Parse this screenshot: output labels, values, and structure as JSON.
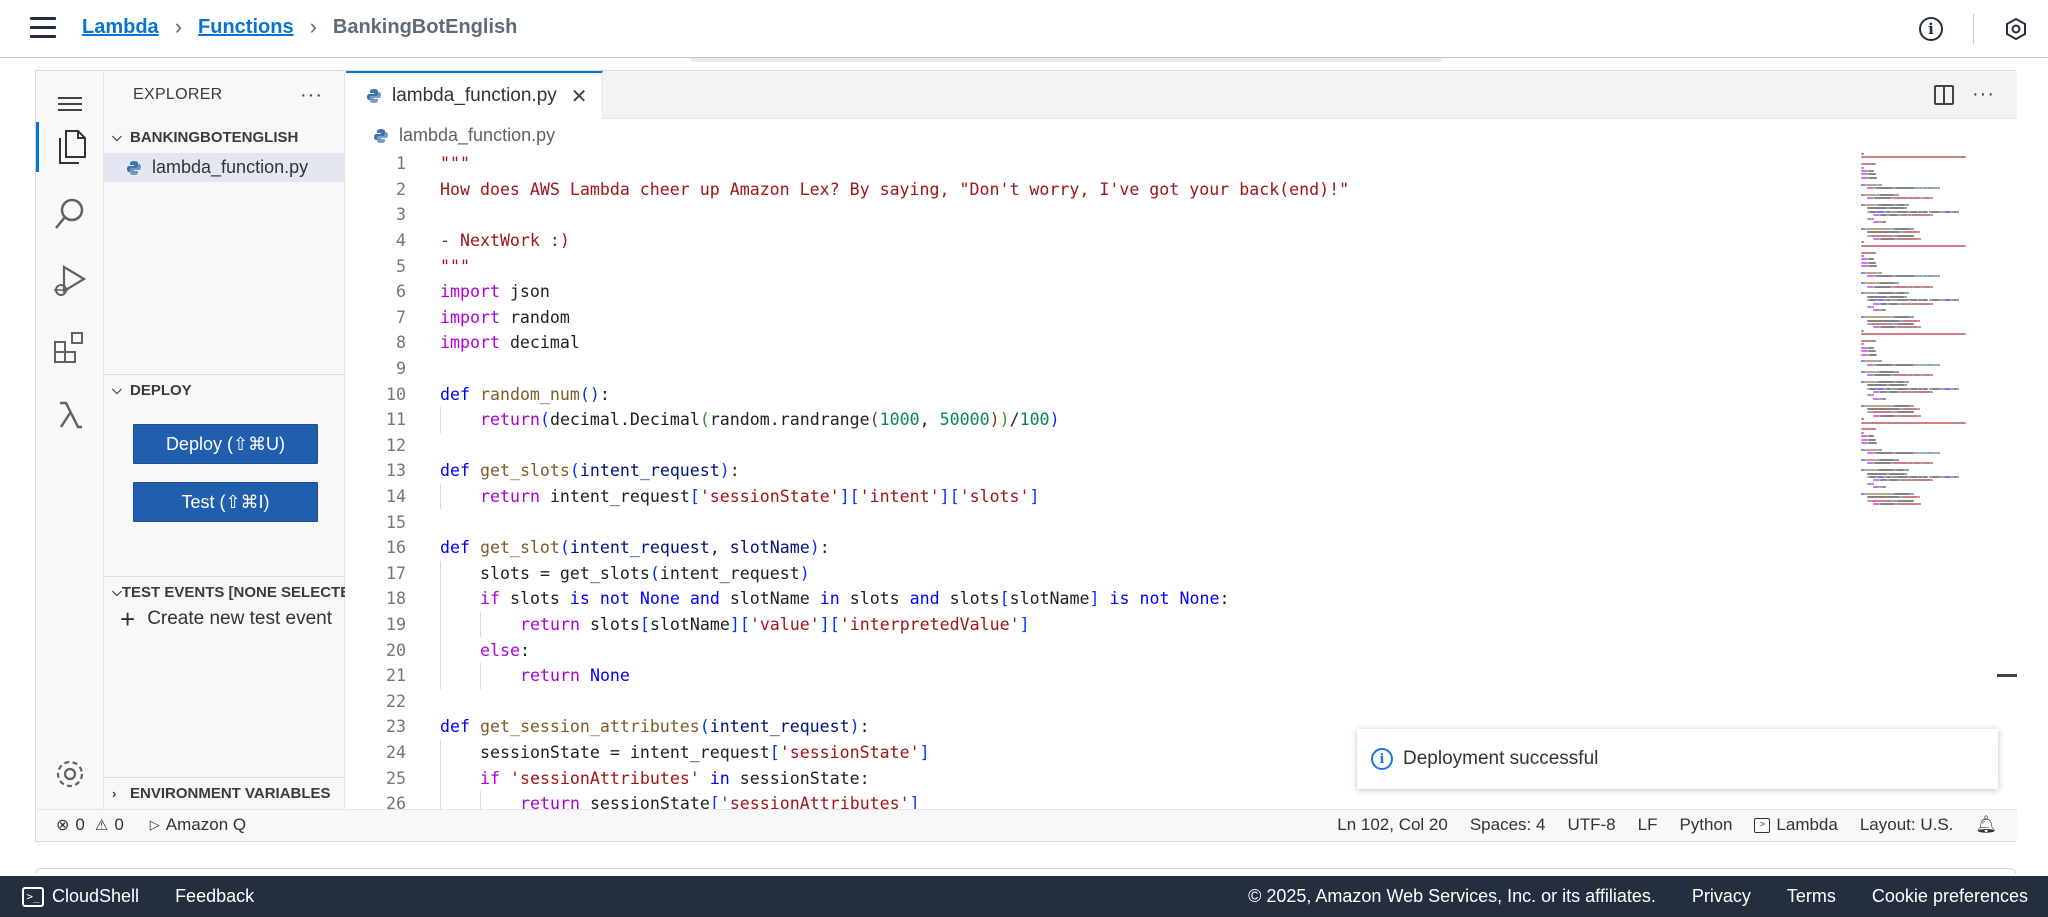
{
  "breadcrumb": {
    "items": [
      "Lambda",
      "Functions"
    ],
    "current": "BankingBotEnglish"
  },
  "sidebar": {
    "explorer_title": "EXPLORER",
    "folder_name": "BANKINGBOTENGLISH",
    "file_name": "lambda_function.py",
    "deploy_section": "DEPLOY",
    "deploy_button": "Deploy (⇧⌘U)",
    "test_button": "Test (⇧⌘I)",
    "test_events_section": "TEST EVENTS [NONE SELECTED]",
    "create_test_event": "Create new test event",
    "env_section": "ENVIRONMENT VARIABLES"
  },
  "editor": {
    "tab_label": "lambda_function.py",
    "path": "lambda_function.py"
  },
  "code_lines": [
    {
      "n": "1",
      "indent": 0,
      "tokens": [
        [
          "str",
          "\"\"\""
        ]
      ]
    },
    {
      "n": "2",
      "indent": 0,
      "tokens": [
        [
          "str",
          "How does AWS Lambda cheer up Amazon Lex? By saying, \"Don't worry, I've got your back(end)!\""
        ]
      ]
    },
    {
      "n": "3",
      "indent": 0,
      "tokens": []
    },
    {
      "n": "4",
      "indent": 0,
      "tokens": [
        [
          "str",
          "- NextWork :)"
        ]
      ]
    },
    {
      "n": "5",
      "indent": 0,
      "tokens": [
        [
          "str",
          "\"\"\""
        ]
      ]
    },
    {
      "n": "6",
      "indent": 0,
      "tokens": [
        [
          "kw",
          "import"
        ],
        [
          "",
          " json"
        ]
      ]
    },
    {
      "n": "7",
      "indent": 0,
      "tokens": [
        [
          "kw",
          "import"
        ],
        [
          "",
          " random"
        ]
      ]
    },
    {
      "n": "8",
      "indent": 0,
      "tokens": [
        [
          "kw",
          "import"
        ],
        [
          "",
          " decimal"
        ]
      ]
    },
    {
      "n": "9",
      "indent": 0,
      "tokens": []
    },
    {
      "n": "10",
      "indent": 0,
      "tokens": [
        [
          "kw2",
          "def"
        ],
        [
          "",
          " "
        ],
        [
          "fn",
          "random_num"
        ],
        [
          "brk",
          "()"
        ],
        [
          "",
          ":"
        ]
      ]
    },
    {
      "n": "11",
      "indent": 1,
      "tokens": [
        [
          "kw",
          "return"
        ],
        [
          "brk",
          "("
        ],
        [
          "",
          "decimal.Decimal"
        ],
        [
          "brk2",
          "("
        ],
        [
          "",
          "random.randrange"
        ],
        [
          "brk3",
          "("
        ],
        [
          "num",
          "1000"
        ],
        [
          "",
          ", "
        ],
        [
          "num",
          "50000"
        ],
        [
          "brk3",
          ")"
        ],
        [
          "brk2",
          ")"
        ],
        [
          "",
          "/"
        ],
        [
          "num",
          "100"
        ],
        [
          "brk",
          ")"
        ]
      ]
    },
    {
      "n": "12",
      "indent": 0,
      "tokens": []
    },
    {
      "n": "13",
      "indent": 0,
      "tokens": [
        [
          "kw2",
          "def"
        ],
        [
          "",
          " "
        ],
        [
          "fn",
          "get_slots"
        ],
        [
          "brk",
          "("
        ],
        [
          "prm",
          "intent_request"
        ],
        [
          "brk",
          ")"
        ],
        [
          "",
          ":"
        ]
      ]
    },
    {
      "n": "14",
      "indent": 1,
      "tokens": [
        [
          "kw",
          "return"
        ],
        [
          "",
          " intent_request"
        ],
        [
          "brk",
          "["
        ],
        [
          "str",
          "'sessionState'"
        ],
        [
          "brk",
          "]["
        ],
        [
          "str",
          "'intent'"
        ],
        [
          "brk",
          "]["
        ],
        [
          "str",
          "'slots'"
        ],
        [
          "brk",
          "]"
        ]
      ]
    },
    {
      "n": "15",
      "indent": 0,
      "tokens": []
    },
    {
      "n": "16",
      "indent": 0,
      "tokens": [
        [
          "kw2",
          "def"
        ],
        [
          "",
          " "
        ],
        [
          "fn",
          "get_slot"
        ],
        [
          "brk",
          "("
        ],
        [
          "prm",
          "intent_request"
        ],
        [
          "",
          ", "
        ],
        [
          "prm",
          "slotName"
        ],
        [
          "brk",
          ")"
        ],
        [
          "",
          ":"
        ]
      ]
    },
    {
      "n": "17",
      "indent": 1,
      "tokens": [
        [
          "",
          "slots = get_slots"
        ],
        [
          "brk",
          "("
        ],
        [
          "",
          "intent_request"
        ],
        [
          "brk",
          ")"
        ]
      ]
    },
    {
      "n": "18",
      "indent": 1,
      "tokens": [
        [
          "kw",
          "if"
        ],
        [
          "",
          " slots "
        ],
        [
          "kw2",
          "is not"
        ],
        [
          "",
          " "
        ],
        [
          "cnst",
          "None"
        ],
        [
          "",
          " "
        ],
        [
          "kw2",
          "and"
        ],
        [
          "",
          " slotName "
        ],
        [
          "kw2",
          "in"
        ],
        [
          "",
          " slots "
        ],
        [
          "kw2",
          "and"
        ],
        [
          "",
          " slots"
        ],
        [
          "brk",
          "["
        ],
        [
          "",
          "slotName"
        ],
        [
          "brk",
          "]"
        ],
        [
          "",
          " "
        ],
        [
          "kw2",
          "is not"
        ],
        [
          "",
          " "
        ],
        [
          "cnst",
          "None"
        ],
        [
          "",
          ":"
        ]
      ]
    },
    {
      "n": "19",
      "indent": 2,
      "tokens": [
        [
          "kw",
          "return"
        ],
        [
          "",
          " slots"
        ],
        [
          "brk",
          "["
        ],
        [
          "",
          "slotName"
        ],
        [
          "brk",
          "]["
        ],
        [
          "str",
          "'value'"
        ],
        [
          "brk",
          "]["
        ],
        [
          "str",
          "'interpretedValue'"
        ],
        [
          "brk",
          "]"
        ]
      ]
    },
    {
      "n": "20",
      "indent": 1,
      "tokens": [
        [
          "kw",
          "else"
        ],
        [
          "",
          ":"
        ]
      ]
    },
    {
      "n": "21",
      "indent": 2,
      "tokens": [
        [
          "kw",
          "return"
        ],
        [
          "",
          " "
        ],
        [
          "cnst",
          "None"
        ]
      ]
    },
    {
      "n": "22",
      "indent": 0,
      "tokens": []
    },
    {
      "n": "23",
      "indent": 0,
      "tokens": [
        [
          "kw2",
          "def"
        ],
        [
          "",
          " "
        ],
        [
          "fn",
          "get_session_attributes"
        ],
        [
          "brk",
          "("
        ],
        [
          "prm",
          "intent_request"
        ],
        [
          "brk",
          ")"
        ],
        [
          "",
          ":"
        ]
      ]
    },
    {
      "n": "24",
      "indent": 1,
      "tokens": [
        [
          "",
          "sessionState = intent_request"
        ],
        [
          "brk",
          "["
        ],
        [
          "str",
          "'sessionState'"
        ],
        [
          "brk",
          "]"
        ]
      ]
    },
    {
      "n": "25",
      "indent": 1,
      "tokens": [
        [
          "kw",
          "if"
        ],
        [
          "",
          " "
        ],
        [
          "str",
          "'sessionAttributes'"
        ],
        [
          "",
          " "
        ],
        [
          "kw2",
          "in"
        ],
        [
          "",
          " sessionState:"
        ]
      ]
    },
    {
      "n": "26",
      "indent": 2,
      "tokens": [
        [
          "kw",
          "return"
        ],
        [
          "",
          " sessionState"
        ],
        [
          "brk",
          "["
        ],
        [
          "str",
          "'sessionAttributes'"
        ],
        [
          "brk",
          "]"
        ]
      ]
    }
  ],
  "toast": {
    "message": "Deployment successful"
  },
  "statusbar": {
    "errors": "0",
    "warnings": "0",
    "amazon_q": "Amazon Q",
    "position": "Ln 102, Col 20",
    "spaces": "Spaces: 4",
    "encoding": "UTF-8",
    "eol": "LF",
    "language": "Python",
    "lambda": "Lambda",
    "layout": "Layout: U.S."
  },
  "footer": {
    "cloudshell": "CloudShell",
    "feedback": "Feedback",
    "copyright": "© 2025, Amazon Web Services, Inc. or its affiliates.",
    "privacy": "Privacy",
    "terms": "Terms",
    "cookies": "Cookie preferences"
  },
  "colors": {
    "accent": "#0972d3",
    "button_bg": "#1f5fad",
    "footer_bg": "#232f3e",
    "string": "#a31515",
    "keyword": "#af00db",
    "number": "#098658"
  }
}
